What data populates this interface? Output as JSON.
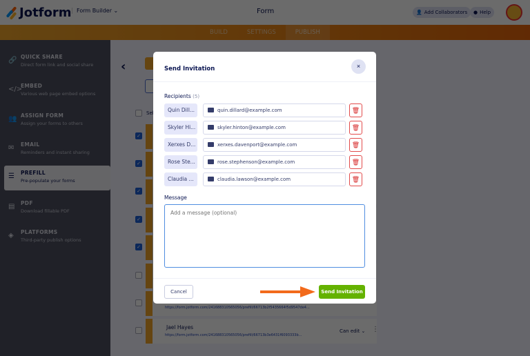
{
  "header": {
    "brand": "Jotform",
    "builder": "Form Builder",
    "title": "Form",
    "add_collaborators": "Add Collaborators",
    "help": "Help"
  },
  "nav": {
    "tabs": [
      "BUILD",
      "SETTINGS",
      "PUBLISH"
    ],
    "active": "PUBLISH"
  },
  "sidebar": {
    "items": [
      {
        "title": "QUICK SHARE",
        "desc": "Direct form link and social share",
        "icon": "link-icon"
      },
      {
        "title": "EMBED",
        "desc": "Various web page embed options",
        "icon": "code-icon"
      },
      {
        "title": "ASSIGN FORM",
        "desc": "Assign your forms to others",
        "icon": "users-icon"
      },
      {
        "title": "EMAIL",
        "desc": "Reminders and instant sharing",
        "icon": "envelope-icon"
      },
      {
        "title": "PREFILL",
        "desc": "Pre-populate your forms",
        "icon": "prefill-icon"
      },
      {
        "title": "PDF",
        "desc": "Download fillable PDF",
        "icon": "pdf-icon"
      },
      {
        "title": "PLATFORMS",
        "desc": "Third-party publish options",
        "icon": "layers-icon"
      }
    ]
  },
  "list": {
    "select_all": "Sel",
    "rows": [
      {
        "link": "https://form.jotform.com/241688310565056/prefill/66713b2f5435664f5d9547de4...",
        "name": ""
      },
      {
        "name": "Jael Hayes",
        "link": "https://form.jotform.com/241688310565056/prefill/66713b3e6431f6093333b...",
        "permission": "Can edit"
      }
    ]
  },
  "modal": {
    "title": "Send Invitation",
    "close": "×",
    "recipients_label": "Recipients",
    "recipients_count": "(5)",
    "recipients": [
      {
        "name": "Quin Dill...",
        "email": "quin.dillard@example.com"
      },
      {
        "name": "Skyler Hi...",
        "email": "skyler.hinton@example.com"
      },
      {
        "name": "Xerxes D...",
        "email": "xerxes.davenport@example.com"
      },
      {
        "name": "Rose Ste...",
        "email": "rose.stephenson@example.com"
      },
      {
        "name": "Claudia ...",
        "email": "claudia.lawson@example.com"
      }
    ],
    "message_label": "Message",
    "message_placeholder": "Add a message (optional)",
    "message_value": "",
    "cancel": "Cancel",
    "send": "Send Invitation"
  },
  "colors": {
    "accent": "#64b200",
    "arrow": "#f26a1b",
    "danger": "#e24b4b"
  }
}
